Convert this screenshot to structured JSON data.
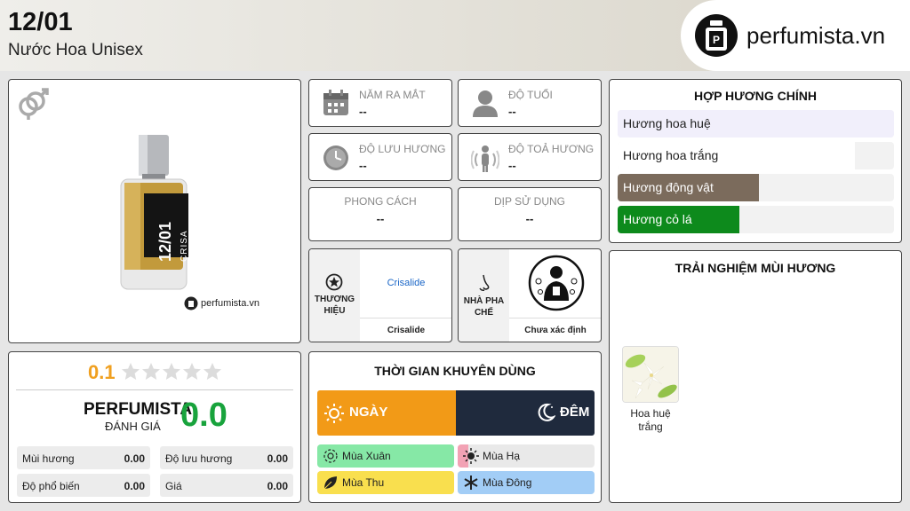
{
  "header": {
    "title": "12/01",
    "subtitle": "Nước Hoa Unisex",
    "logo_text": "perfumista.vn"
  },
  "product": {
    "bottle_label": "12/01",
    "bottle_brand": "CRISA",
    "bottle_extrait": "EXTRAIT DE",
    "watermark": "perfumista.vn"
  },
  "info": {
    "release": {
      "label": "NĂM RA MẮT",
      "value": "--"
    },
    "age": {
      "label": "ĐỘ TUỔI",
      "value": "--"
    },
    "longevity": {
      "label": "ĐỘ LƯU HƯƠNG",
      "value": "--"
    },
    "sillage": {
      "label": "ĐỘ TOẢ HƯƠNG",
      "value": "--"
    },
    "style": {
      "label": "PHONG CÁCH",
      "value": "--"
    },
    "occasion": {
      "label": "DỊP SỬ DỤNG",
      "value": "--"
    }
  },
  "brand": {
    "label": "THƯƠNG HIỆU",
    "link": "Crisalide",
    "name": "Crisalide"
  },
  "perfumer": {
    "label": "NHÀ PHA CHẾ",
    "name": "Chưa xác định"
  },
  "accords": {
    "title": "HỢP HƯƠNG CHÍNH",
    "items": [
      {
        "name": "Hương hoa huệ",
        "value": 100,
        "color": "#f1effb",
        "text": "#222222"
      },
      {
        "name": "Hương hoa trắng",
        "value": 86,
        "color": "#ffffff",
        "text": "#222222"
      },
      {
        "name": "Hương động vật",
        "value": 51,
        "color": "#7b6b5c",
        "text": "#ffffff"
      },
      {
        "name": "Hương cỏ lá",
        "value": 44,
        "color": "#0d8a1c",
        "text": "#ffffff"
      }
    ]
  },
  "experience": {
    "title": "TRẢI NGHIỆM MÙI HƯƠNG",
    "notes": [
      {
        "name": "Hoa huệ trắng"
      }
    ]
  },
  "rating": {
    "user_score": "0.1",
    "stars": 5,
    "filled_stars": 0,
    "brand": "PERFUMISTA",
    "brand_sub": "ĐÁNH GIÁ",
    "score": "0.0",
    "stats": [
      {
        "label": "Mùi hương",
        "value": "0.00"
      },
      {
        "label": "Độ lưu hương",
        "value": "0.00"
      },
      {
        "label": "Độ phổ biến",
        "value": "0.00"
      },
      {
        "label": "Giá",
        "value": "0.00"
      }
    ]
  },
  "time": {
    "title": "THỜI GIAN KHUYÊN DÙNG",
    "day": {
      "label": "NGÀY",
      "value": 100,
      "color": "#f29a17"
    },
    "night": {
      "label": "ĐÊM",
      "value": 100,
      "color": "#1f2a3d"
    },
    "seasons": [
      {
        "name": "Mùa Xuân",
        "value": 100,
        "color": "#86e8a6"
      },
      {
        "name": "Mùa Hạ",
        "value": 8,
        "color": "#f2a2b4"
      },
      {
        "name": "Mùa Thu",
        "value": 100,
        "color": "#f9df4e"
      },
      {
        "name": "Mùa Đông",
        "value": 100,
        "color": "#a2cdf6"
      }
    ]
  }
}
